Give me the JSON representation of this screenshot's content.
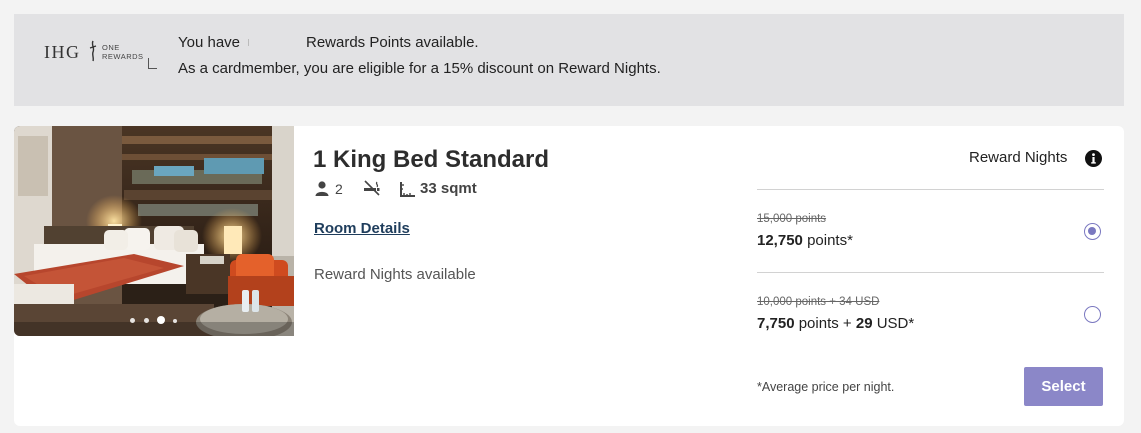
{
  "banner": {
    "logo_ihg": "IHG",
    "logo_one": "ONE",
    "logo_rewards": "REWARDS",
    "points_prefix": "You have",
    "points_suffix": "Rewards Points available.",
    "cardmember_text": "As a cardmember, you are eligible for a 15% discount on Reward Nights."
  },
  "room": {
    "title": "1 King Bed Standard",
    "guests": "2",
    "room_size": "33 sqmt",
    "details_link": "Room Details",
    "availability": "Reward Nights available",
    "photo_carousel": {
      "total_slides": 4,
      "active_index": 2
    }
  },
  "rates": {
    "header": "Reward Nights",
    "options": [
      {
        "old_price": "15,000 points",
        "new_points": "12,750",
        "points_unit": "points*",
        "selected": true
      },
      {
        "old_price": "10,000 points + 34 USD",
        "new_points": "7,750",
        "points_unit": "points",
        "plus": "+",
        "cash_amount": "29",
        "cash_unit": "USD*",
        "selected": false
      }
    ],
    "footnote": "*Average price per night.",
    "select_label": "Select"
  },
  "colors": {
    "accent": "#8b87c8",
    "radio": "#7a78c0",
    "link": "#1f3d5c",
    "banner_bg": "#e2e2e4"
  },
  "icons": [
    "ihg-logo-mark",
    "person-icon",
    "no-smoking-icon",
    "room-size-icon",
    "info-icon"
  ]
}
